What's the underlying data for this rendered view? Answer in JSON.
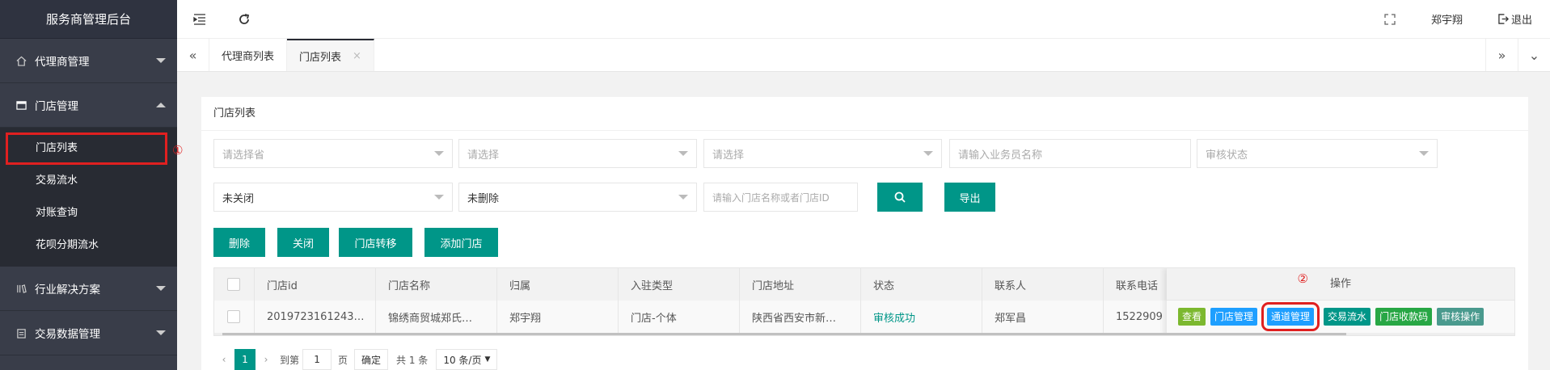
{
  "app": {
    "title": "服务商管理后台"
  },
  "sidebar": {
    "groups": [
      {
        "label": "代理商管理"
      },
      {
        "label": "门店管理"
      },
      {
        "label": "行业解决方案"
      },
      {
        "label": "交易数据管理"
      }
    ],
    "store_items": [
      "门店列表",
      "交易流水",
      "对账查询",
      "花呗分期流水"
    ]
  },
  "annotations": {
    "one": "①",
    "two": "②"
  },
  "header": {
    "user": "郑宇翔",
    "logout": "退出"
  },
  "tabs": [
    {
      "label": "代理商列表"
    },
    {
      "label": "门店列表"
    }
  ],
  "panel": {
    "title": "门店列表"
  },
  "filters": {
    "province": "请选择省",
    "select2": "请选择",
    "select3": "请选择",
    "salesman_placeholder": "请输入业务员名称",
    "audit_status": "审核状态",
    "closed_status": "未关闭",
    "deleted_status": "未删除",
    "store_search_placeholder": "请输入门店名称或者门店ID",
    "export": "导出"
  },
  "actions": [
    "删除",
    "关闭",
    "门店转移",
    "添加门店"
  ],
  "table": {
    "columns": [
      "门店id",
      "门店名称",
      "归属",
      "入驻类型",
      "门店地址",
      "状态",
      "联系人",
      "联系电话"
    ],
    "ops_header": "操作",
    "rows": [
      [
        "2019723161243…",
        "锦绣商贸城郑氏…",
        "郑宇翔",
        "门店-个体",
        "陕西省西安市新…",
        "审核成功",
        "郑军昌",
        "1522909"
      ]
    ],
    "ops_buttons": [
      "查看",
      "门店管理",
      "通道管理",
      "交易流水",
      "门店收款码",
      "审核操作"
    ]
  },
  "pager": {
    "current": "1",
    "goto": "到第",
    "page_value": "1",
    "page_unit": "页",
    "confirm": "确定",
    "total": "共 1 条",
    "size": "10 条/页"
  },
  "colors": {
    "sidebar": "#393d49",
    "primary": "#009688",
    "blue": "#1e9fff",
    "highlight": "#e02020"
  }
}
